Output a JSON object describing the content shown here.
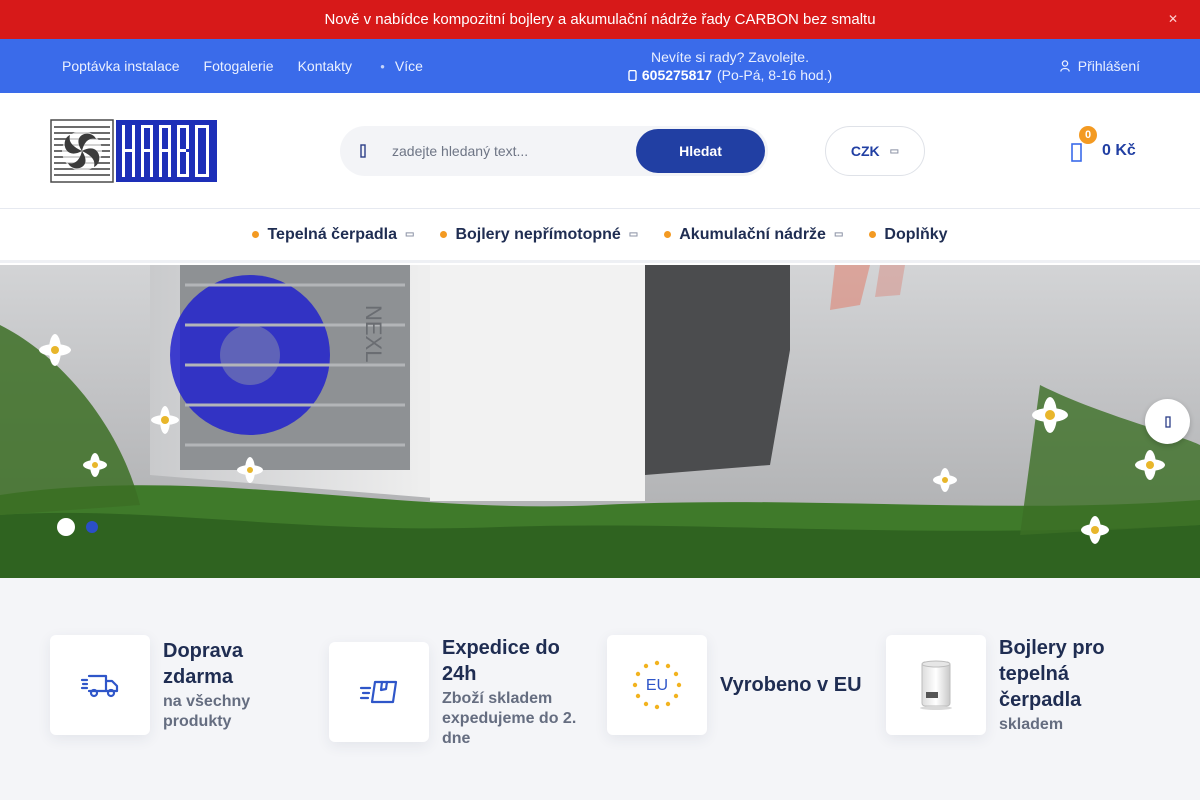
{
  "announcement": {
    "text": "Nově v nabídce kompozitní bojlery a akumulační nádrže řady CARBON bez smaltu",
    "close_icon": "close-icon"
  },
  "topbar": {
    "links": [
      "Poptávka instalace",
      "Fotogalerie",
      "Kontakty"
    ],
    "more_label": "Více",
    "help_line": "Nevíte si rady? Zavolejte.",
    "phone": "605275817",
    "hours": "(Po-Pá, 8-16 hod.)",
    "login_label": "Přihlášení"
  },
  "header": {
    "logo_text": "HAABO",
    "search_placeholder": "zadejte hledaný text...",
    "search_button": "Hledat",
    "currency": "CZK",
    "cart_count": "0",
    "cart_total": "0 Kč"
  },
  "categories": [
    "Tepelná čerpadla",
    "Bojlery nepřímotopné",
    "Akumulační nádrže",
    "Doplňky"
  ],
  "hero": {
    "active_slide": 1,
    "slide_count": 2
  },
  "features": [
    {
      "title": "Doprava zdarma",
      "subtitle": "na všechny produkty",
      "icon": "truck-icon"
    },
    {
      "title": "Expedice do 24h",
      "subtitle": "Zboží skladem expedujeme do 2. dne",
      "icon": "fast-box-icon"
    },
    {
      "title": "Vyrobeno v EU",
      "subtitle": "",
      "icon": "eu-stars-icon"
    },
    {
      "title": "Bojlery pro tepelná čerpadla",
      "subtitle": "skladem",
      "icon": "boiler-icon"
    }
  ],
  "colors": {
    "announce": "#d71919",
    "topbar": "#3a6bea",
    "primary": "#213fa3",
    "accent": "#f39a22"
  }
}
